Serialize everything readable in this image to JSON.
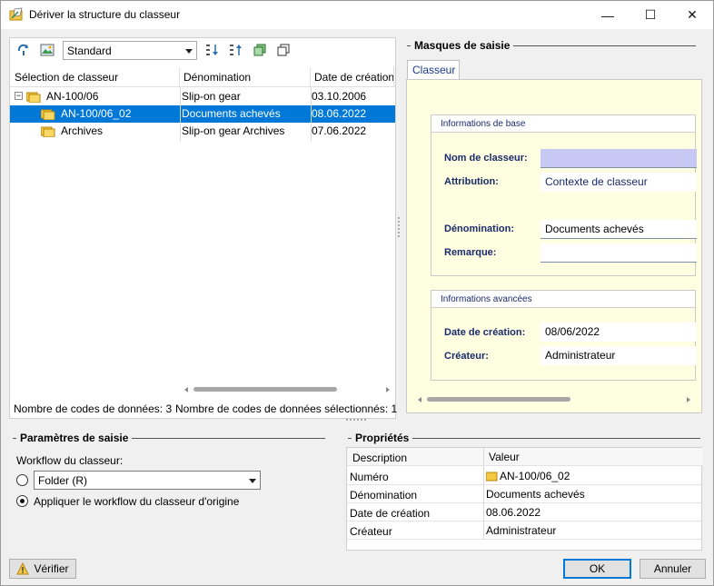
{
  "window": {
    "title": "Dériver la structure du classeur",
    "minimize": "—",
    "maximize": "☐",
    "close": "✕"
  },
  "toolbar": {
    "view_combo": "Standard"
  },
  "tree": {
    "columns": [
      "Sélection de classeur",
      "Dénomination",
      "Date de création"
    ],
    "rows": [
      {
        "name": "AN-100/06",
        "denomination": "Slip-on gear",
        "date": "03.10.2006",
        "expander": "−"
      },
      {
        "name": "AN-100/06_02",
        "denomination": "Documents achevés",
        "date": "08.06.2022"
      },
      {
        "name": "Archives",
        "denomination": "Slip-on gear Archives",
        "date": "07.06.2022"
      }
    ]
  },
  "status": {
    "count": "Nombre de codes de données: 3",
    "selected": "Nombre de codes de données sélectionnés: 1"
  },
  "masks": {
    "title": "Masques de saisie",
    "tab": "Classeur",
    "group_base": "Informations de base",
    "group_adv": "Informations avancées",
    "fields": {
      "nom_label": "Nom de classeur:",
      "nom_value": "",
      "attribution_label": "Attribution:",
      "attribution_value": "Contexte de classeur",
      "denomination_label": "Dénomination:",
      "denomination_value": "Documents achevés",
      "remarque_label": "Remarque:",
      "remarque_value": "",
      "date_label": "Date de création:",
      "date_value": "08/06/2022",
      "createur_label": "Créateur:",
      "createur_value": "Administrateur"
    }
  },
  "params": {
    "title": "Paramètres de saisie",
    "workflow_label": "Workflow du classeur:",
    "workflow_value": "Folder (R)",
    "option_original": "Appliquer le workflow du classeur d'origine"
  },
  "props": {
    "title": "Propriétés",
    "col_desc": "Description",
    "col_val": "Valeur",
    "rows": [
      {
        "desc": "Numéro",
        "val": "AN-100/06_02"
      },
      {
        "desc": "Dénomination",
        "val": "Documents achevés"
      },
      {
        "desc": "Date de création",
        "val": "08.06.2022"
      },
      {
        "desc": "Créateur",
        "val": "Administrateur"
      }
    ]
  },
  "buttons": {
    "verify": "Vérifier",
    "ok": "OK",
    "cancel": "Annuler"
  }
}
